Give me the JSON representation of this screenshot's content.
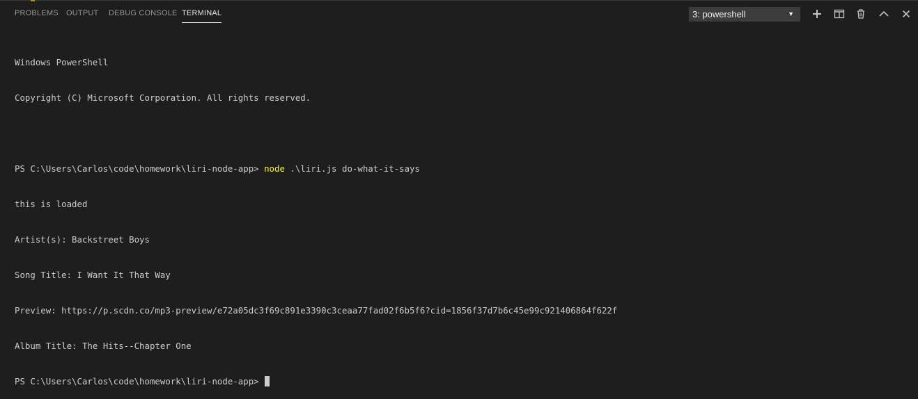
{
  "tabs": [
    {
      "label": "PROBLEMS",
      "active": false
    },
    {
      "label": "OUTPUT",
      "active": false
    },
    {
      "label": "DEBUG CONSOLE",
      "active": false
    },
    {
      "label": "TERMINAL",
      "active": true
    }
  ],
  "terminal_select": {
    "value": "3: powershell"
  },
  "actions": [
    "plus-icon",
    "split-icon",
    "trash-icon",
    "chevron-up-icon",
    "close-icon"
  ],
  "terminal": {
    "header1": "Windows PowerShell",
    "header2": "Copyright (C) Microsoft Corporation. All rights reserved.",
    "prompt": "PS C:\\Users\\Carlos\\code\\homework\\liri-node-app> ",
    "command_keyword": "node",
    "command_args": " .\\liri.js do-what-it-says",
    "output": [
      "this is loaded",
      "Artist(s): Backstreet Boys",
      "Song Title: I Want It That Way",
      "Preview: https://p.scdn.co/mp3-preview/e72a05dc3f69c891e3390c3ceaa77fad02f6b5f6?cid=1856f37d7b6c45e99c921406864f622f",
      "Album Title: The Hits--Chapter One"
    ],
    "final_prompt": "PS C:\\Users\\Carlos\\code\\homework\\liri-node-app> "
  },
  "colors": {
    "background": "#1e1e1e",
    "text": "#cccccc",
    "command": "#f5f543",
    "tab_active": "#e7e7e7",
    "tab_inactive": "#969696"
  }
}
